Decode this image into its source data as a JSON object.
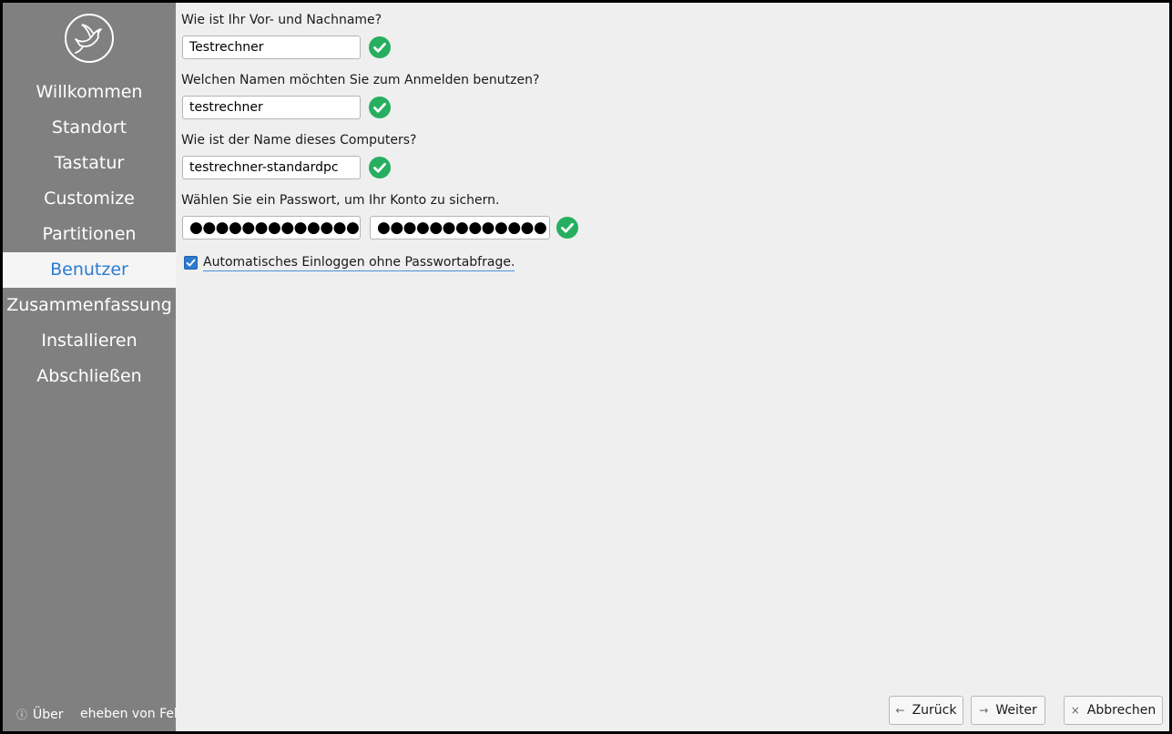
{
  "sidebar": {
    "items": [
      {
        "label": "Willkommen"
      },
      {
        "label": "Standort"
      },
      {
        "label": "Tastatur"
      },
      {
        "label": "Customize"
      },
      {
        "label": "Partitionen"
      },
      {
        "label": "Benutzer",
        "active": true
      },
      {
        "label": "Zusammenfassung"
      },
      {
        "label": "Installieren"
      },
      {
        "label": "Abschließen"
      }
    ],
    "footer": {
      "about_icon": "info-icon",
      "about_label": "Über",
      "debug_label": "eheben von Feh"
    },
    "logo_icon": "bird-logo-icon"
  },
  "form": {
    "fullname": {
      "question": "Wie ist Ihr Vor- und Nachname?",
      "value": "Testrechner"
    },
    "username": {
      "question": "Welchen Namen möchten Sie zum Anmelden benutzen?",
      "value": "testrechner"
    },
    "hostname": {
      "question": "Wie ist der Name dieses Computers?",
      "value": "testrechner-standardpc"
    },
    "password": {
      "question": "Wählen Sie ein Passwort, um Ihr Konto zu sichern.",
      "value": "●●●●●●●●●●●●●",
      "confirm": "●●●●●●●●●●●●●"
    },
    "autologin": {
      "label": "Automatisches Einloggen ohne Passwortabfrage.",
      "checked": true
    },
    "valid_icon": "check-circle-icon"
  },
  "buttons": {
    "back": {
      "label": "Zurück",
      "icon": "arrow-left-icon"
    },
    "next": {
      "label": "Weiter",
      "icon": "arrow-right-icon"
    },
    "cancel": {
      "label": "Abbrechen",
      "icon": "close-icon"
    }
  },
  "colors": {
    "sidebar_bg": "#808080",
    "active_item_text": "#2c7bd1",
    "valid_green": "#27ae60",
    "content_bg": "#efefef"
  }
}
